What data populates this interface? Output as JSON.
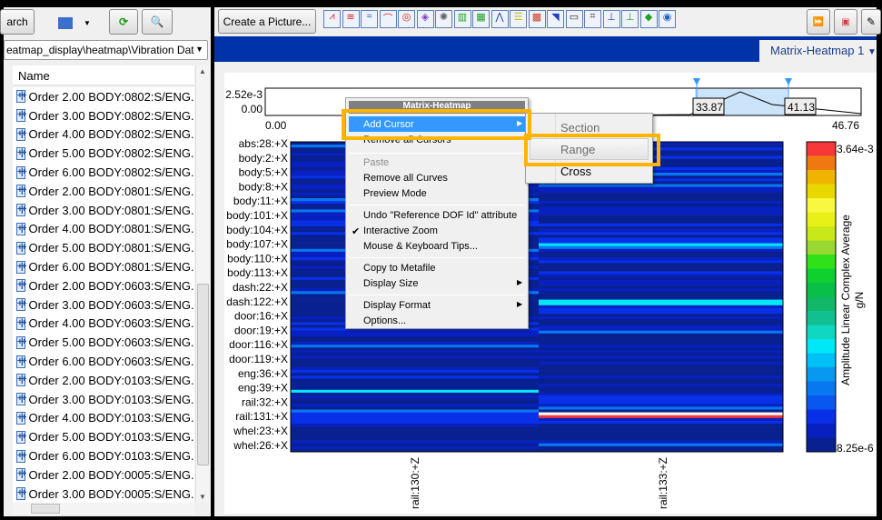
{
  "left_panel": {
    "search_label": "arch",
    "path": "eatmap_display\\heatmap\\Vibration Dat",
    "column_header": "Name",
    "items": [
      "Order 2.00 BODY:0802:S/ENG...",
      "Order 3.00 BODY:0802:S/ENG...",
      "Order 4.00 BODY:0802:S/ENG...",
      "Order 5.00 BODY:0802:S/ENG...",
      "Order 6.00 BODY:0802:S/ENG...",
      "Order 2.00 BODY:0801:S/ENG...",
      "Order 3.00 BODY:0801:S/ENG...",
      "Order 4.00 BODY:0801:S/ENG...",
      "Order 5.00 BODY:0801:S/ENG...",
      "Order 6.00 BODY:0801:S/ENG...",
      "Order 2.00 BODY:0603:S/ENG...",
      "Order 3.00 BODY:0603:S/ENG...",
      "Order 4.00 BODY:0603:S/ENG...",
      "Order 5.00 BODY:0603:S/ENG...",
      "Order 6.00 BODY:0603:S/ENG...",
      "Order 2.00 BODY:0103:S/ENG...",
      "Order 3.00 BODY:0103:S/ENG...",
      "Order 4.00 BODY:0103:S/ENG...",
      "Order 5.00 BODY:0103:S/ENG...",
      "Order 6.00 BODY:0103:S/ENG...",
      "Order 2.00 BODY:0005:S/ENG...",
      "Order 3.00 BODY:0005:S/ENG..."
    ],
    "item_icon": "waveform-icon"
  },
  "toolbar": {
    "create_picture": "Create a Picture..."
  },
  "tab": {
    "label": "Matrix-Heatmap 1",
    "icon": "triangle-down"
  },
  "context_menu": {
    "title": "Matrix-Heatmap",
    "items": [
      "Add Cursor",
      "Remove all Cursors",
      "Paste",
      "Remove all Curves",
      "Preview Mode",
      "Undo \"Reference DOF Id\" attribute",
      "Interactive Zoom",
      "Mouse & Keyboard Tips...",
      "Copy to Metafile",
      "Display Size",
      "Display Format",
      "Options..."
    ],
    "checked": "Interactive Zoom",
    "disabled": [
      "Paste"
    ],
    "highlighted": "Add Cursor"
  },
  "submenu": {
    "items": [
      "Section",
      "Range",
      "Cross"
    ],
    "highlighted": "Range"
  },
  "chart_data": [
    {
      "type": "line",
      "ylim_labels": [
        "2.52e-3",
        "0.00"
      ],
      "x_labels": [
        "0.00",
        "46.76"
      ],
      "cursors": [
        "33.87",
        "41.13"
      ]
    },
    {
      "type": "heatmap",
      "rows": [
        "abs:28:+X",
        "body:2:+X",
        "body:5:+X",
        "body:8:+X",
        "body:11:+X",
        "body:101:+X",
        "body:104:+X",
        "body:107:+X",
        "body:110:+X",
        "body:113:+X",
        "dash:22:+X",
        "dash:122:+X",
        "door:16:+X",
        "door:19:+X",
        "door:116:+X",
        "door:119:+X",
        "eng:36:+X",
        "eng:39:+X",
        "rail:32:+X",
        "rail:131:+X",
        "whel:23:+X",
        "whel:26:+X"
      ],
      "columns": [
        "rail:130:+Z",
        "rail:133:+Z"
      ],
      "colorbar": {
        "max": "3.64e-3",
        "min": "8.25e-6",
        "label": "Amplitude  Linear Complex Average",
        "unit": "g/N",
        "colors": [
          "#f83838",
          "#f07810",
          "#f0b400",
          "#e8d800",
          "#f8f840",
          "#e8f018",
          "#c8e818",
          "#98d830",
          "#30e018",
          "#10d030",
          "#08c048",
          "#10b868",
          "#10c090",
          "#10d8c0",
          "#00e8f8",
          "#00c0f8",
          "#0898f0",
          "#0878f0",
          "#0858f0",
          "#0830e8",
          "#0820c0",
          "#082090"
        ]
      }
    }
  ]
}
